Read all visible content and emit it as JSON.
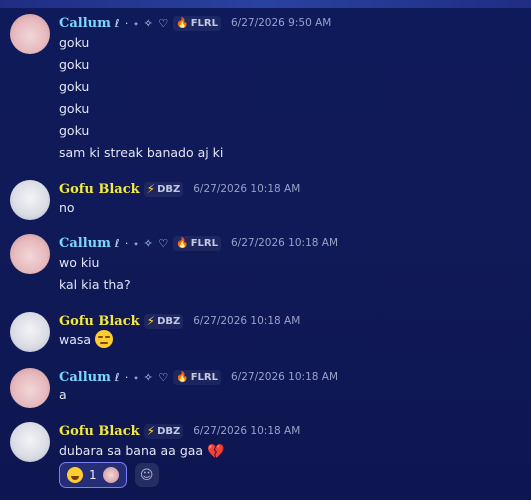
{
  "messages": [
    {
      "user": "Callum",
      "deco": "ℓ · ˖ ✧ ♡",
      "badge": "FLRL",
      "time": "6/27/2026 9:50 AM",
      "lines": [
        "goku",
        "goku",
        "goku",
        "goku",
        "goku",
        "sam ki streak banado aj ki"
      ]
    },
    {
      "user": "Gofu Black",
      "badge": "DBZ",
      "time": "6/27/2026 10:18 AM",
      "lines": [
        "no"
      ]
    },
    {
      "user": "Callum",
      "deco": "ℓ · ˖ ✧ ♡",
      "badge": "FLRL",
      "time": "6/27/2026 10:18 AM",
      "lines": [
        "wo kiu",
        "kal kia tha?"
      ]
    },
    {
      "user": "Gofu Black",
      "badge": "DBZ",
      "time": "6/27/2026 10:18 AM",
      "lines": [
        "wasa"
      ]
    },
    {
      "user": "Callum",
      "deco": "ℓ · ˖ ✧ ♡",
      "badge": "FLRL",
      "time": "6/27/2026 10:18 AM",
      "lines": [
        "a"
      ]
    },
    {
      "user": "Gofu Black",
      "badge": "DBZ",
      "time": "6/27/2026 10:18 AM",
      "lines": [
        "dubara sa bana aa gaa"
      ]
    }
  ],
  "reactions": [
    {
      "emoji": "crying-face",
      "count": "1"
    }
  ],
  "icons": {
    "flame": "🔥",
    "bolt": "⚡",
    "heart": "💔",
    "add_reaction": "☺"
  },
  "colors": {
    "callum_name": "#7fd6ff",
    "gofu_name": "#f4ea3b",
    "reaction_border": "#7b7ff5"
  }
}
